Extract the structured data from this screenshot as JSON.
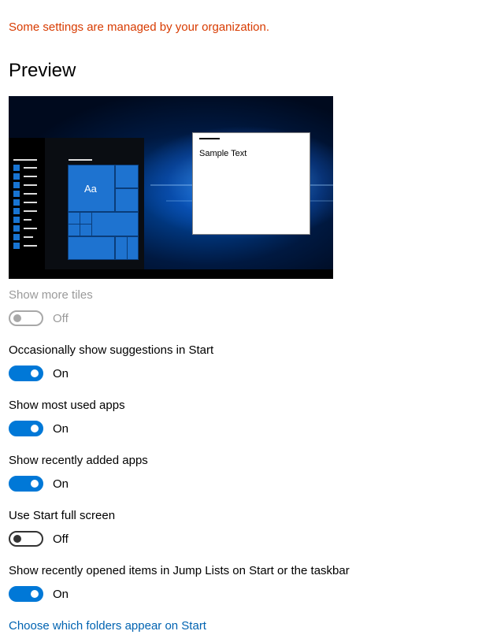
{
  "managed_notice": "Some settings are managed by your organization.",
  "preview": {
    "title": "Preview",
    "tile_text": "Aa",
    "sample_text": "Sample Text"
  },
  "settings": [
    {
      "label": "Show more tiles",
      "state": "Off",
      "on": false,
      "disabled": true
    },
    {
      "label": "Occasionally show suggestions in Start",
      "state": "On",
      "on": true,
      "disabled": false
    },
    {
      "label": "Show most used apps",
      "state": "On",
      "on": true,
      "disabled": false
    },
    {
      "label": "Show recently added apps",
      "state": "On",
      "on": true,
      "disabled": false
    },
    {
      "label": "Use Start full screen",
      "state": "Off",
      "on": false,
      "disabled": false
    },
    {
      "label": "Show recently opened items in Jump Lists on Start or the taskbar",
      "state": "On",
      "on": true,
      "disabled": false
    }
  ],
  "folders_link": "Choose which folders appear on Start",
  "colors": {
    "accent": "#0078d7",
    "warning": "#d83b01",
    "link": "#0063b1"
  }
}
